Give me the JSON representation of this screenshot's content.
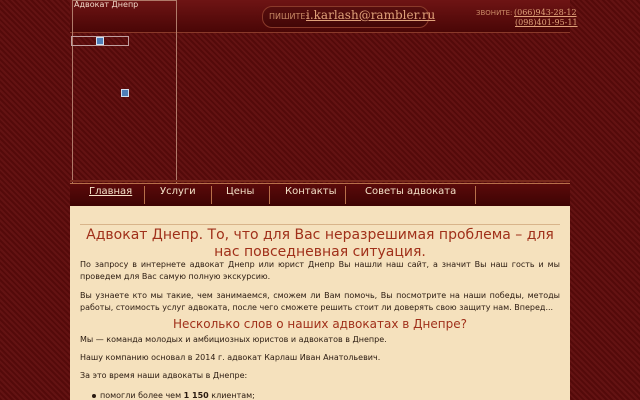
{
  "header": {
    "banner_title": "Адвокат Днепр",
    "write_label": "ПИШИТЕ:",
    "email": "i.karlash@rambler.ru",
    "call_label": "ЗВОНИТЕ:",
    "phone1": "(066)943-28-12",
    "phone2": "(098)401-95-11"
  },
  "nav": {
    "items": [
      {
        "label": "Главная"
      },
      {
        "label": "Услуги"
      },
      {
        "label": "Цены"
      },
      {
        "label": "Контакты"
      },
      {
        "label": "Советы адвоката"
      }
    ]
  },
  "content": {
    "heading": "Адвокат Днепр. То, что для Вас неразрешимая проблема – для нас повседневная ситуация.",
    "intro": "По запросу в интернете адвокат Днепр или юрист Днепр Вы нашли наш сайт, а значит Вы наш гость и мы проведем для Вас самую полную экскурсию.",
    "second": "Вы узнаете кто мы такие, чем занимаемся, сможем ли Вам помочь, Вы посмотрите на наши победы, методы работы, стоимость услуг адвоката, после чего сможете решить стоит ли доверять свою защиту нам. Вперед...",
    "subheading": "Несколько слов о наших адвокатах в Днепре?",
    "team": "Мы — команда молодых и амбициозных юристов и адвокатов в Днепре.",
    "founded": "Нашу компанию основал в 2014 г. адвокат Карлаш Иван Анатольевич.",
    "during": "За это время наши адвокаты в Днепре:",
    "bullet_prefix": "помогли более чем ",
    "bullet_number": "1 150",
    "bullet_suffix": " клиентам;"
  },
  "colors": {
    "background": "#5e0b0b",
    "content_bg": "#f5e1bd",
    "heading": "#a0301a",
    "nav_text": "#f4e2c8",
    "accent": "#e0a27a"
  }
}
